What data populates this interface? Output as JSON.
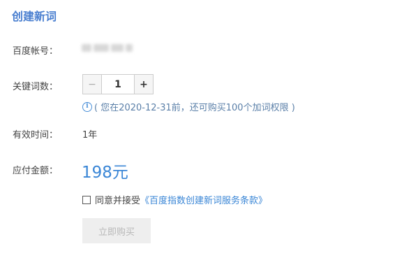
{
  "page": {
    "title": "创建新词"
  },
  "account": {
    "label": "百度帐号："
  },
  "keywords": {
    "label": "关键词数：",
    "minus_label": "−",
    "plus_label": "+",
    "value": "1",
    "hint_icon": "i",
    "hint": "( 您在2020-12-31前，还可购买100个加词权限 )"
  },
  "validity": {
    "label": "有效时间：",
    "value": "1年"
  },
  "payment": {
    "label": "应付金额：",
    "amount": "198元"
  },
  "agreement": {
    "prefix": "同意并接受",
    "link": "《百度指数创建新词服务条款》"
  },
  "buy_button": {
    "label": "立即购买"
  }
}
